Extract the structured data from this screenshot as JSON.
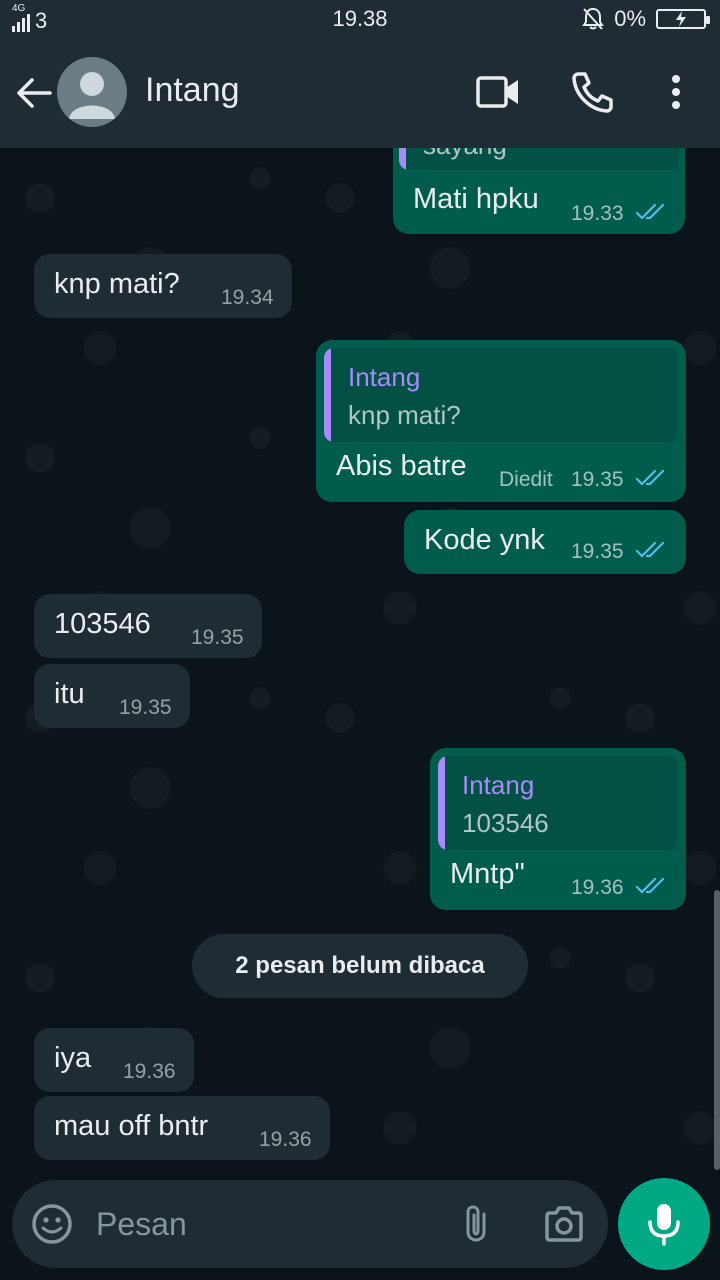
{
  "status_bar": {
    "network": "4G",
    "sim": "3",
    "time": "19.38",
    "battery": "0%"
  },
  "header": {
    "contact_name": "Intang",
    "icons": [
      "back-arrow-icon",
      "avatar",
      "video-call-icon",
      "voice-call-icon",
      "more-options-icon"
    ]
  },
  "messages": [
    {
      "dir": "out",
      "text": "Mati hpku",
      "time": "19.33",
      "status": "read",
      "quote_text_partial": "sayang"
    },
    {
      "dir": "in",
      "text": "knp mati?",
      "time": "19.34"
    },
    {
      "dir": "out",
      "text": "Abis batre",
      "time": "19.35",
      "status": "read",
      "edited": "Diedit",
      "quote": {
        "name": "Intang",
        "text": "knp mati?"
      }
    },
    {
      "dir": "out",
      "text": "Kode ynk",
      "time": "19.35",
      "status": "read"
    },
    {
      "dir": "in",
      "text": "103546",
      "time": "19.35"
    },
    {
      "dir": "in",
      "text": "itu",
      "time": "19.35"
    },
    {
      "dir": "out",
      "text": "Mntp\"",
      "time": "19.36",
      "status": "read",
      "quote": {
        "name": "Intang",
        "text": "103546"
      }
    },
    {
      "dir": "in",
      "text": "iya",
      "time": "19.36"
    },
    {
      "dir": "in",
      "text": "mau off bntr",
      "time": "19.36"
    }
  ],
  "unread_label": "2 pesan belum dibaca",
  "composer": {
    "placeholder": "Pesan",
    "value": ""
  },
  "colors": {
    "background": "#0b141a",
    "header": "#1f2c34",
    "incoming_bubble": "#1f2c34",
    "outgoing_bubble": "#005c4b",
    "quote_accent": "#a78bfa",
    "read_ticks": "#53bdeb",
    "mic_button": "#00a884"
  }
}
